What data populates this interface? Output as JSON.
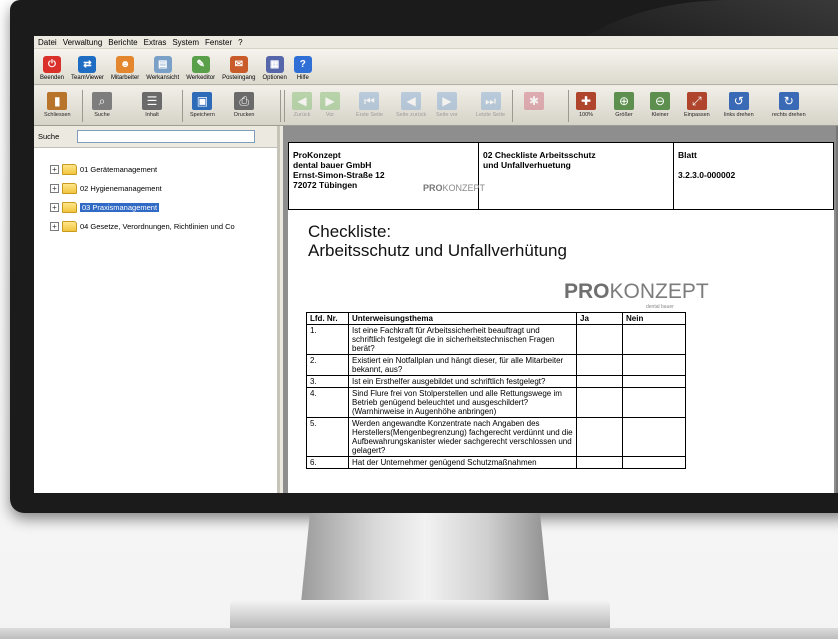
{
  "menu": [
    "Datei",
    "Verwaltung",
    "Berichte",
    "Extras",
    "System",
    "Fenster",
    "?"
  ],
  "toolbar1": [
    {
      "label": "Beenden",
      "icon": "power-icon",
      "color": "#d9302a"
    },
    {
      "label": "TeamViewer",
      "icon": "teamviewer-icon",
      "color": "#1f6dc3"
    },
    {
      "label": "Mitarbeiter",
      "icon": "users-icon",
      "color": "#e3862e"
    },
    {
      "label": "Werkansicht",
      "icon": "document-view-icon",
      "color": "#7aa0c8"
    },
    {
      "label": "Werkeditor",
      "icon": "editor-icon",
      "color": "#5aa04a"
    },
    {
      "label": "Posteingang",
      "icon": "inbox-icon",
      "color": "#c95b2a"
    },
    {
      "label": "Optionen",
      "icon": "options-icon",
      "color": "#5566aa"
    },
    {
      "label": "Hilfe",
      "icon": "help-icon",
      "color": "#2f6fd6"
    }
  ],
  "toolbar2": [
    {
      "label": "Schliessen",
      "icon": "close-book-icon",
      "color": "#b9742c",
      "dis": false
    },
    {
      "label": "Suche",
      "icon": "search-icon",
      "color": "#7d7d7d",
      "dis": false
    },
    {
      "label": "Inhalt",
      "icon": "contents-icon",
      "color": "#6a6a6a",
      "dis": false
    },
    {
      "label": "Speichern",
      "icon": "save-icon",
      "color": "#2d6ab8",
      "dis": false
    },
    {
      "label": "Drucken",
      "icon": "print-icon",
      "color": "#6a6a6a",
      "dis": false
    },
    {
      "label": "Zurück",
      "icon": "back-icon",
      "color": "#8fc27e",
      "dis": true
    },
    {
      "label": "Vor",
      "icon": "forward-icon",
      "color": "#8fc27e",
      "dis": true
    },
    {
      "label": "Erste Seite",
      "icon": "first-page-icon",
      "color": "#8fb0d6",
      "dis": true
    },
    {
      "label": "Seite zurück",
      "icon": "prev-page-icon",
      "color": "#8fb0d6",
      "dis": true
    },
    {
      "label": "Seite vor",
      "icon": "next-page-icon",
      "color": "#8fb0d6",
      "dis": true
    },
    {
      "label": "Letzte Seite",
      "icon": "last-page-icon",
      "color": "#8fb0d6",
      "dis": true
    },
    {
      "label": "",
      "icon": "bookmark-icon",
      "color": "#d27a8a",
      "dis": true
    },
    {
      "label": "100%",
      "icon": "zoom-100-icon",
      "color": "#b0452e",
      "dis": false
    },
    {
      "label": "Größer",
      "icon": "zoom-in-icon",
      "color": "#5d8f4e",
      "dis": false
    },
    {
      "label": "Kleiner",
      "icon": "zoom-out-icon",
      "color": "#5d8f4e",
      "dis": false
    },
    {
      "label": "Einpassen",
      "icon": "fit-icon",
      "color": "#b0452e",
      "dis": false
    },
    {
      "label": "links drehen",
      "icon": "rotate-left-icon",
      "color": "#3a6ab5",
      "dis": false
    },
    {
      "label": "rechts drehen",
      "icon": "rotate-right-icon",
      "color": "#3a6ab5",
      "dis": false
    }
  ],
  "search": {
    "label": "Suche",
    "value": ""
  },
  "tree": [
    {
      "label": "01 Gerätemanagement",
      "selected": false
    },
    {
      "label": "02 Hygienemanagement",
      "selected": false
    },
    {
      "label": "03 Praxismanagement",
      "selected": true
    },
    {
      "label": "04 Gesetze, Verordnungen, Richtlinien und Co",
      "selected": false
    }
  ],
  "doc": {
    "company": [
      "ProKonzept",
      "dental bauer GmbH",
      "Ernst-Simon-Straße 12",
      "72072 Tübingen"
    ],
    "header_logo": {
      "bold": "PRO",
      "rest": "KONZEPT"
    },
    "topic": [
      "02 Checkliste Arbeitsschutz",
      "und Unfallverhuetung"
    ],
    "blatt_label": "Blatt",
    "blatt_no": "3.2.3.0-000002",
    "title_line1": "Checkliste:",
    "title_line2": "Arbeitsschutz und Unfallverhütung",
    "logo": {
      "bold": "PRO",
      "rest": "KONZEPT",
      "sub": "dental bauer"
    },
    "table_headers": [
      "Lfd. Nr.",
      "Unterweisungsthema",
      "Ja",
      "Nein"
    ],
    "rows": [
      {
        "nr": "1.",
        "text": "Ist eine Fachkraft für Arbeitssicherheit beauftragt und schriftlich festgelegt die in sicherheitstechnischen Fragen berät?"
      },
      {
        "nr": "2.",
        "text": "Existiert ein Notfallplan und hängt dieser, für alle Mitarbeiter bekannt, aus?"
      },
      {
        "nr": "3.",
        "text": "Ist ein Ersthelfer ausgebildet und schriftlich festgelegt?"
      },
      {
        "nr": "4.",
        "text": "Sind Flure frei von Stolperstellen und alle Rettungswege im Betrieb genügend beleuchtet und ausgeschildert? (Warnhinweise in Augenhöhe anbringen)"
      },
      {
        "nr": "5.",
        "text": "Werden angewandte Konzentrate nach Angaben des Herstellers(Mengenbegrenzung) fachgerecht verdünnt und die Aufbewahrungskanister wieder sachgerecht verschlossen und gelagert?"
      },
      {
        "nr": "6.",
        "text": "Hat der Unternehmer genügend Schutzmaßnahmen"
      }
    ]
  }
}
